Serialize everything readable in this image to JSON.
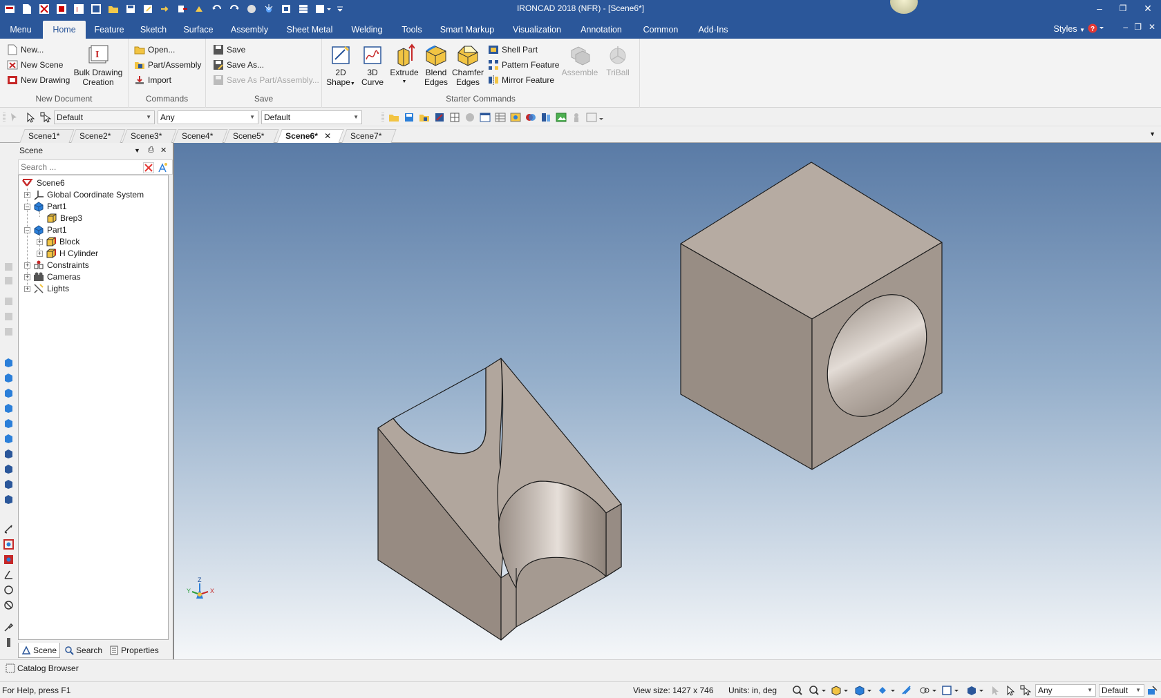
{
  "window": {
    "title": "IRONCAD 2018 (NFR) - [Scene6*]"
  },
  "ribbon_tabs": [
    {
      "label": "Menu"
    },
    {
      "label": "Home"
    },
    {
      "label": "Feature"
    },
    {
      "label": "Sketch"
    },
    {
      "label": "Surface"
    },
    {
      "label": "Assembly"
    },
    {
      "label": "Sheet Metal"
    },
    {
      "label": "Welding"
    },
    {
      "label": "Tools"
    },
    {
      "label": "Smart Markup"
    },
    {
      "label": "Visualization"
    },
    {
      "label": "Annotation"
    },
    {
      "label": "Common"
    },
    {
      "label": "Add-Ins"
    }
  ],
  "active_tab": "Home",
  "styles_label": "Styles",
  "groups": {
    "new_document": {
      "label": "New Document",
      "new": "New...",
      "new_scene": "New Scene",
      "new_drawing": "New Drawing",
      "bulk_line1": "Bulk Drawing",
      "bulk_line2": "Creation"
    },
    "commands": {
      "label": "Commands",
      "open": "Open...",
      "part_assembly": "Part/Assembly",
      "import": "Import"
    },
    "save": {
      "label": "Save",
      "save": "Save",
      "save_as": "Save As...",
      "save_as_part": "Save As Part/Assembly..."
    },
    "starter": {
      "label": "Starter Commands",
      "shape2d_1": "2D",
      "shape2d_2": "Shape",
      "curve3d_1": "3D",
      "curve3d_2": "Curve",
      "extrude": "Extrude",
      "blend_1": "Blend",
      "blend_2": "Edges",
      "chamfer_1": "Chamfer",
      "chamfer_2": "Edges",
      "shell": "Shell Part",
      "pattern": "Pattern Feature",
      "mirror": "Mirror Feature",
      "assemble": "Assemble",
      "triball": "TriBall"
    }
  },
  "toolbar": {
    "combo1": "Default",
    "combo2": "Any",
    "combo3": "Default"
  },
  "scene_tabs": [
    {
      "label": "Scene1*"
    },
    {
      "label": "Scene2*"
    },
    {
      "label": "Scene3*"
    },
    {
      "label": "Scene4*"
    },
    {
      "label": "Scene5*"
    },
    {
      "label": "Scene6*"
    },
    {
      "label": "Scene7*"
    }
  ],
  "active_scene": "Scene6*",
  "scene_panel": {
    "title": "Scene",
    "search_placeholder": "Search ..."
  },
  "tree": [
    {
      "label": "Scene6",
      "level": 0,
      "icon": "scene-icon"
    },
    {
      "label": "Global Coordinate System",
      "level": 1,
      "icon": "axes-icon"
    },
    {
      "label": "Part1",
      "level": 1,
      "icon": "part-icon"
    },
    {
      "label": "Brep3",
      "level": 2,
      "icon": "brep-icon"
    },
    {
      "label": "Part1",
      "level": 1,
      "icon": "part-icon"
    },
    {
      "label": "Block",
      "level": 2,
      "icon": "block-icon"
    },
    {
      "label": "H Cylinder",
      "level": 2,
      "icon": "cylinder-icon"
    },
    {
      "label": "Constraints",
      "level": 1,
      "icon": "constraints-icon"
    },
    {
      "label": "Cameras",
      "level": 1,
      "icon": "camera-icon"
    },
    {
      "label": "Lights",
      "level": 1,
      "icon": "light-icon"
    }
  ],
  "panel_tabs": [
    {
      "label": "Scene"
    },
    {
      "label": "Search"
    },
    {
      "label": "Properties"
    }
  ],
  "catalog_browser": "Catalog Browser",
  "status": {
    "help": "For Help, press F1",
    "view_size": "View size: 1427 x  746",
    "units": "Units: in, deg",
    "combo_any": "Any",
    "combo_default": "Default"
  },
  "colors": {
    "title_blue": "#2b579a",
    "viewport_top": "#5a7ba6",
    "viewport_bottom": "#f5f7f9",
    "part_face": "#b2a79e"
  }
}
